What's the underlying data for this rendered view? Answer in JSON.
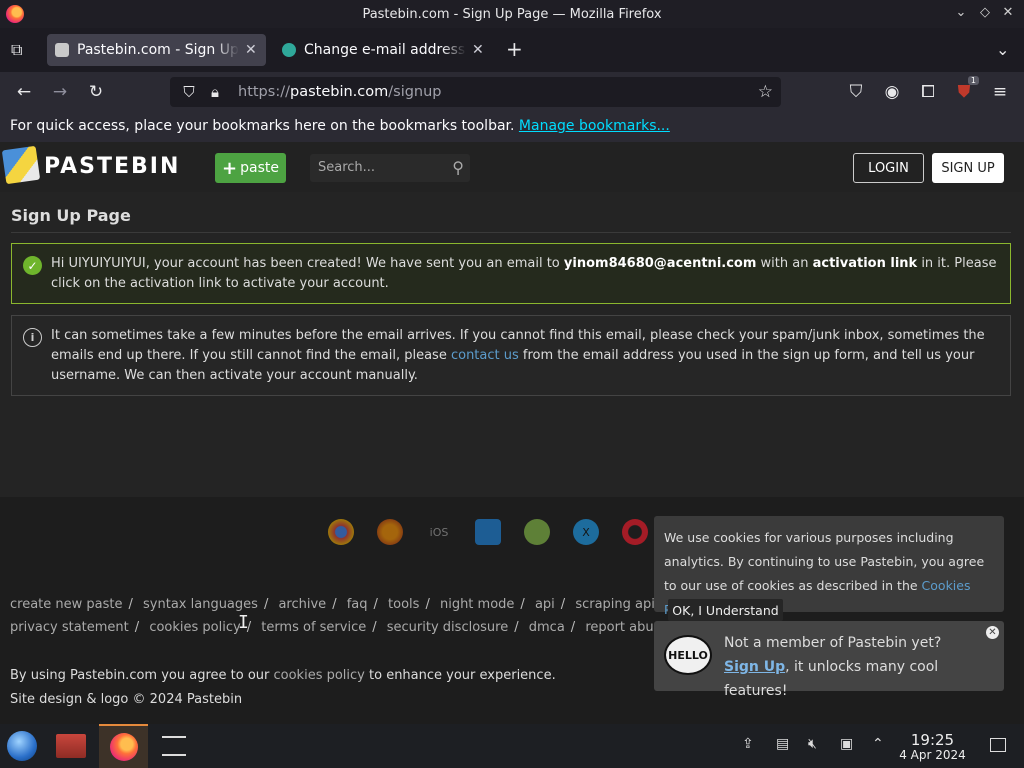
{
  "window": {
    "title": "Pastebin.com - Sign Up Page — Mozilla Firefox"
  },
  "tabs": [
    {
      "label": "Pastebin.com - Sign Up Page",
      "active": true
    },
    {
      "label": "Change e-mail address -",
      "active": false
    }
  ],
  "navbar": {
    "url_scheme": "https://",
    "url_host": "pastebin.com",
    "url_path": "/signup",
    "extension_badge": "1"
  },
  "bookmarks": {
    "text": "For quick access, place your bookmarks here on the bookmarks toolbar.",
    "link": "Manage bookmarks..."
  },
  "site_header": {
    "logo_text": "PASTEBIN",
    "paste_label": "paste",
    "search_placeholder": "Search...",
    "login_label": "LOGIN",
    "signup_label": "SIGN UP"
  },
  "main": {
    "title": "Sign Up Page",
    "success": {
      "part1": "Hi UIYUIYUIYUI, your account has been created! We have sent you an email to ",
      "email": "yinom84680@acentni.com",
      "part2": " with an ",
      "bold2": "activation link",
      "part3": " in it. Please click on the activation link to activate your account."
    },
    "info": {
      "part1": "It can sometimes take a few minutes before the email arrives. If you cannot find this email, please check your spam/junk inbox, sometimes the emails end up there. If you still cannot find the email, please ",
      "link": "contact us",
      "part2": " from the email address you used in the sign up form, and tell us your username. We can then activate your account manually."
    }
  },
  "apps": [
    "chrome",
    "firefox",
    "iOS",
    "windows",
    "android",
    "x",
    "opera"
  ],
  "footer": {
    "links_row1": [
      "create new paste",
      "syntax languages",
      "archive",
      "faq",
      "tools",
      "night mode",
      "api",
      "scraping api"
    ],
    "links_row2": [
      "privacy statement",
      "cookies policy",
      "terms of service",
      "security disclosure",
      "dmca",
      "report abuse"
    ],
    "consent_part1": "By using Pastebin.com you agree to our ",
    "consent_link": "cookies policy",
    "consent_part2": " to enhance your experience.",
    "copyright": "Site design & logo © 2024 Pastebin"
  },
  "cookie_banner": {
    "text": "We use cookies for various purposes including analytics. By continuing to use Pastebin, you agree to our use of cookies as described in the ",
    "link": "Cookies Policy",
    "end": ".",
    "button": "OK, I Understand"
  },
  "member_popup": {
    "icon_text": "HELLO",
    "line1": "Not a member of Pastebin yet?",
    "link": "Sign Up",
    "line2": ", it unlocks many cool features!"
  },
  "taskbar": {
    "time": "19:25",
    "date": "4 Apr 2024"
  }
}
